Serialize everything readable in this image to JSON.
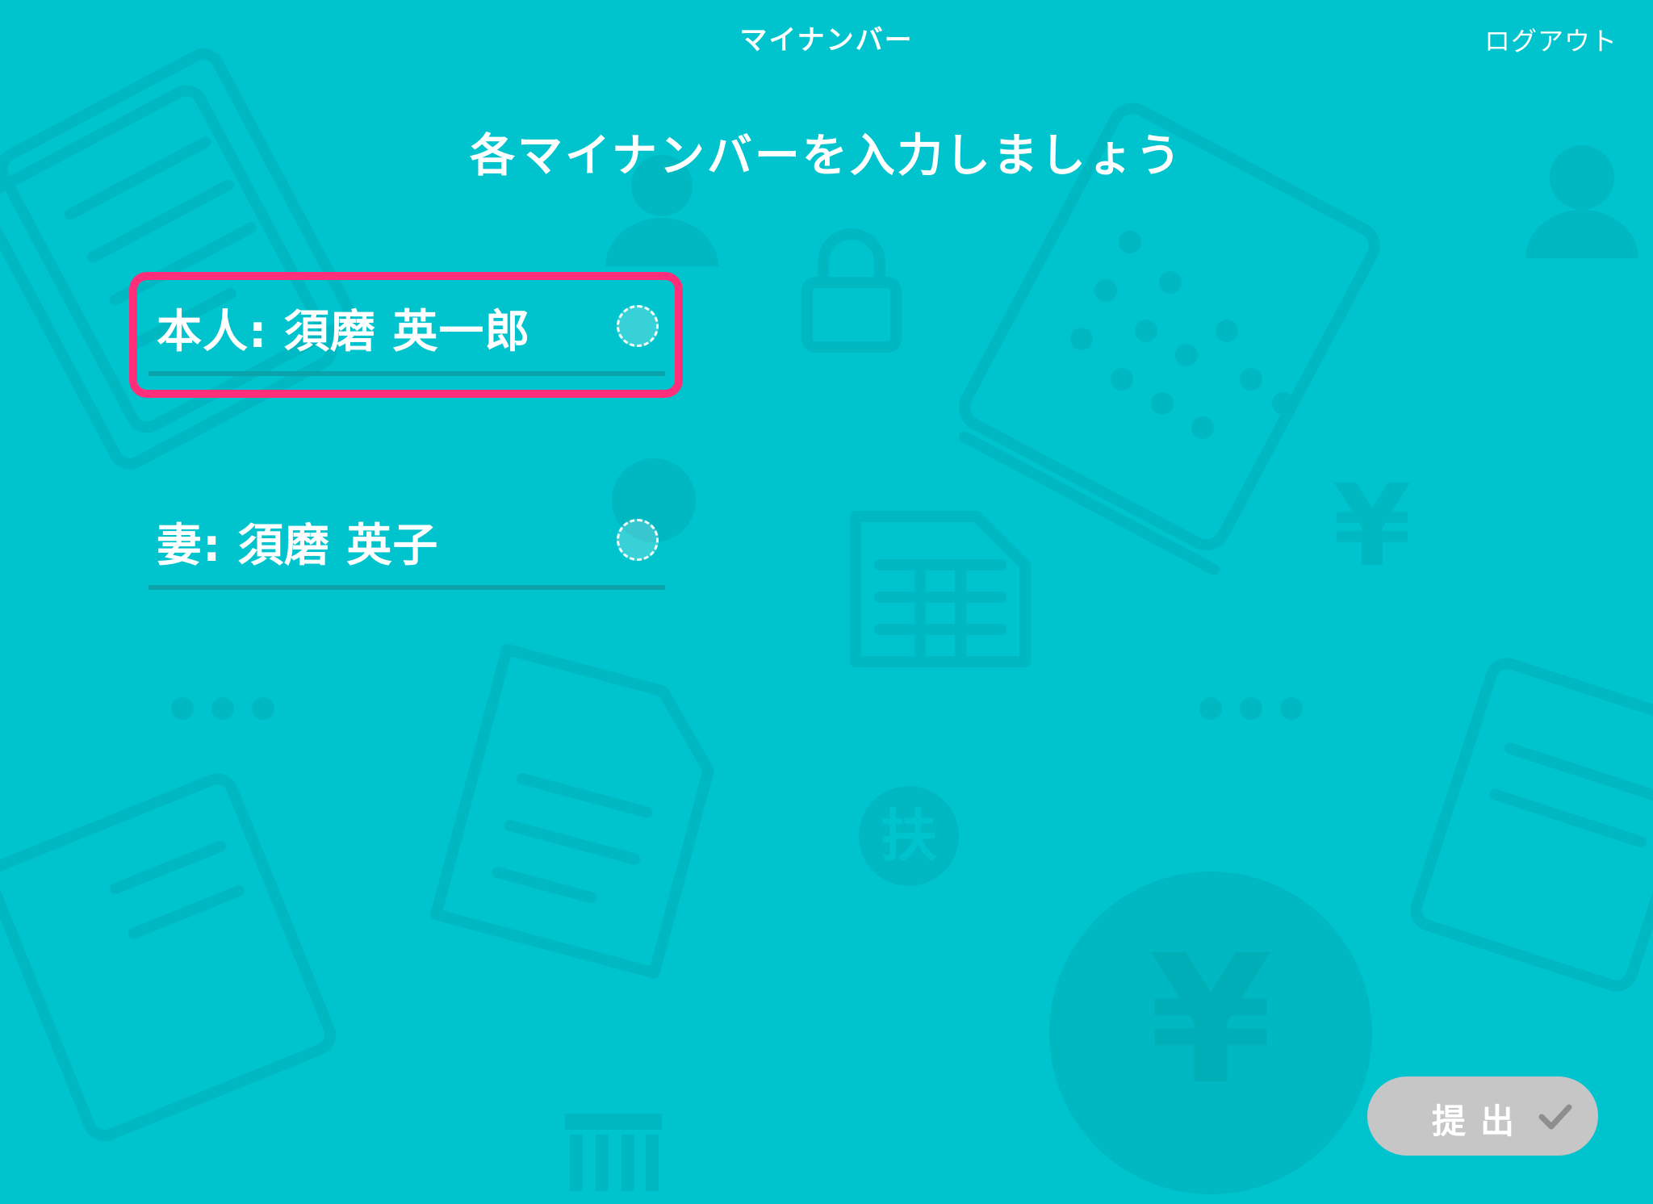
{
  "header": {
    "title": "マイナンバー",
    "logout_label": "ログアウト"
  },
  "main": {
    "heading": "各マイナンバーを入力しましょう",
    "fields": [
      {
        "label": "本人: 須磨 英一郎",
        "selected": true
      },
      {
        "label": "妻: 須磨 英子",
        "selected": false
      }
    ]
  },
  "footer": {
    "submit_label": "提出"
  },
  "background_icons": {
    "glyph": "扶",
    "yen_symbol": "¥"
  },
  "colors": {
    "background": "#00C4CD",
    "highlight": "#FF2E7A",
    "submit_bg": "#C6C6C6"
  }
}
